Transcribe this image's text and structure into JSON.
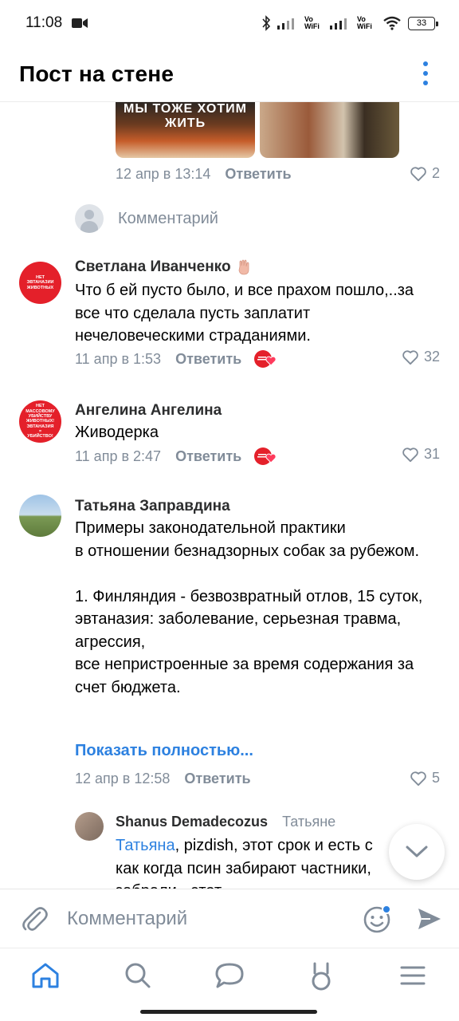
{
  "status_bar": {
    "time": "11:08",
    "battery": "33",
    "network_1": "Vo WiFi",
    "network_2": "Vo WiFi"
  },
  "header": {
    "title": "Пост на стене"
  },
  "post_media": {
    "photo1_caption": "МЫ ТОЖЕ ХОТИМ ЖИТЬ"
  },
  "first_comment_meta": {
    "time": "12 апр в 13:14",
    "reply_label": "Ответить",
    "likes": "2"
  },
  "inline_comment": {
    "placeholder": "Комментарий"
  },
  "comments": [
    {
      "author": "Светлана Иванченко",
      "avatar_text": [
        "НЕТ",
        "ЭВТАНАЗИИ",
        "ЖИВОТНЫХ"
      ],
      "text": "Что б ей пусто было, и все прахом пошло,..за все что сделала пусть заплатит нечеловеческими страданиями.",
      "time": "11 апр в 1:53",
      "reply_label": "Ответить",
      "likes": "32"
    },
    {
      "author": "Ангелина Ангелина",
      "avatar_text": [
        "НЕТ",
        "МАССОВОМУ",
        "УБИЙСТВУ",
        "ЖИВОТНЫХ!",
        "ЭВТАНАЗИЯ",
        "=",
        "УБИЙСТВО!"
      ],
      "text": "Живодерка",
      "time": "11 апр в 2:47",
      "reply_label": "Ответить",
      "likes": "31"
    },
    {
      "author": "Татьяна Заправдина",
      "text": "Примеры законодательной практики\nв отношении безнадзорных собак за рубежом.\n\n1. Финляндия - безвозвратный отлов, 15 суток, эвтаназия: заболевание, серьезная травма,\nагрессия,\nвсе непристроенные за время содержания за счет бюджета.",
      "show_more": "Показать полностью...",
      "time": "12 апр в 12:58",
      "reply_label": "Ответить",
      "likes": "5"
    }
  ],
  "reply": {
    "author": "Shanus Demadecozus",
    "reply_to": "Татьяне",
    "mention": "Татьяна",
    "text_after_mention": ", pizdish, этот срок и есть с",
    "line2": "как когда псин забирают частники,",
    "line3": "забрали - этот"
  },
  "compose": {
    "placeholder": "Комментарий"
  },
  "colors": {
    "accent": "#2d81e0",
    "secondary_text": "#818c99",
    "avatar_red": "#e4202a"
  }
}
